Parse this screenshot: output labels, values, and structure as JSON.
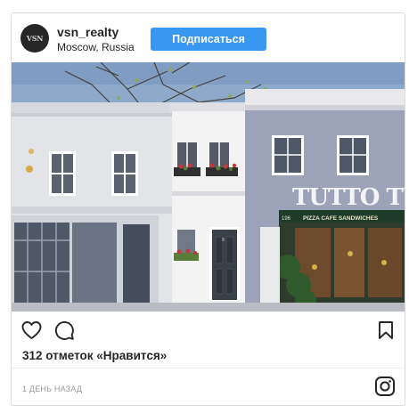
{
  "post": {
    "username": "vsn_realty",
    "location": "Moscow, Russia",
    "avatar_text": "VSN",
    "follow_label": "Подписаться",
    "likes_text": "312 отметок «Нравится»",
    "time_text": "1 ДЕНЬ НАЗАД"
  },
  "photo": {
    "shop_sign": "TUTTO TUCCI",
    "shop_fascia": "PIZZA  CAFE  SANDWICHES",
    "shop_number": "196",
    "door_number": "8"
  },
  "icons": {
    "like": "heart-icon",
    "comment": "comment-icon",
    "save": "bookmark-icon",
    "brand": "instagram-icon"
  },
  "colors": {
    "follow_button": "#3897f0",
    "text": "#262626",
    "muted": "#999999",
    "border": "#dbdbdb"
  }
}
